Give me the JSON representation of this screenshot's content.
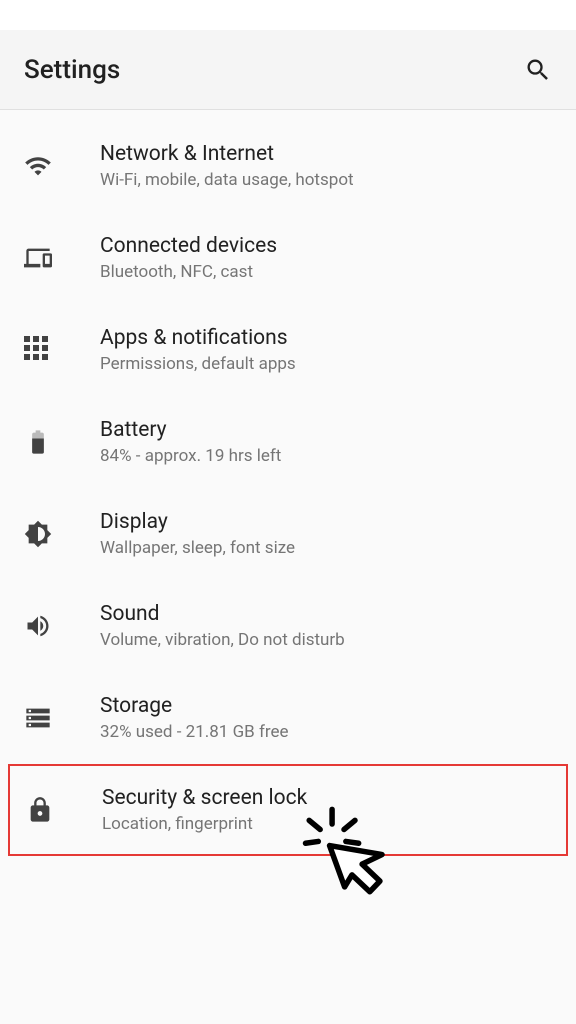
{
  "header": {
    "title": "Settings"
  },
  "items": [
    {
      "title": "Network & Internet",
      "sub": "Wi-Fi, mobile, data usage, hotspot"
    },
    {
      "title": "Connected devices",
      "sub": "Bluetooth, NFC, cast"
    },
    {
      "title": "Apps & notifications",
      "sub": "Permissions, default apps"
    },
    {
      "title": "Battery",
      "sub": "84% - approx. 19 hrs left"
    },
    {
      "title": "Display",
      "sub": "Wallpaper, sleep, font size"
    },
    {
      "title": "Sound",
      "sub": "Volume, vibration, Do not disturb"
    },
    {
      "title": "Storage",
      "sub": "32% used - 21.81 GB free"
    },
    {
      "title": "Security & screen lock",
      "sub": "Location, fingerprint"
    }
  ]
}
